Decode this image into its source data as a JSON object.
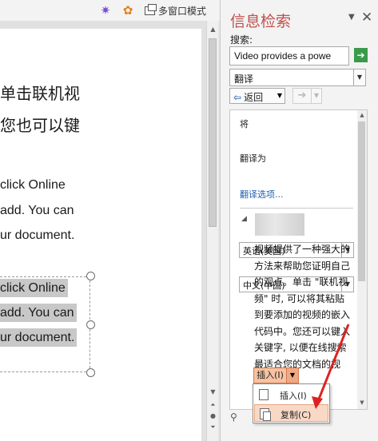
{
  "toolbar": {
    "multi_window_label": "多窗口模式"
  },
  "document": {
    "lines_top": [
      "单击联机视",
      "您也可以键"
    ],
    "lines_en": [
      "click Online",
      "add. You can",
      "ur document."
    ],
    "lines_selected": [
      "click Online",
      "add. You can",
      "ur document."
    ]
  },
  "pane": {
    "title": "信息检索",
    "search_label": "搜索:",
    "search_value": "Video provides a powe",
    "service_value": "翻译",
    "back_label": "返回",
    "from_label": "将",
    "from_value": "英语(美国)",
    "to_label": "翻译为",
    "to_value": "中文(中国)",
    "options_link": "翻译选项...",
    "translation_text": "视频提供了一种强大的方法来帮助您证明自己的观点。单击 \"联机视频\" 时, 可以将其粘贴到要添加的视频的嵌入代码中。您还可以键入关键字, 以便在线搜索最适合您的文档的视频。",
    "insert_label": "插入(I)",
    "menu_insert": "插入(I)",
    "menu_copy": "复制(C)"
  },
  "colors": {
    "title_red": "#c0504d",
    "insert_orange": "#f5c3a3",
    "arrow_red": "#e02020",
    "link_blue": "#1f5fae"
  }
}
